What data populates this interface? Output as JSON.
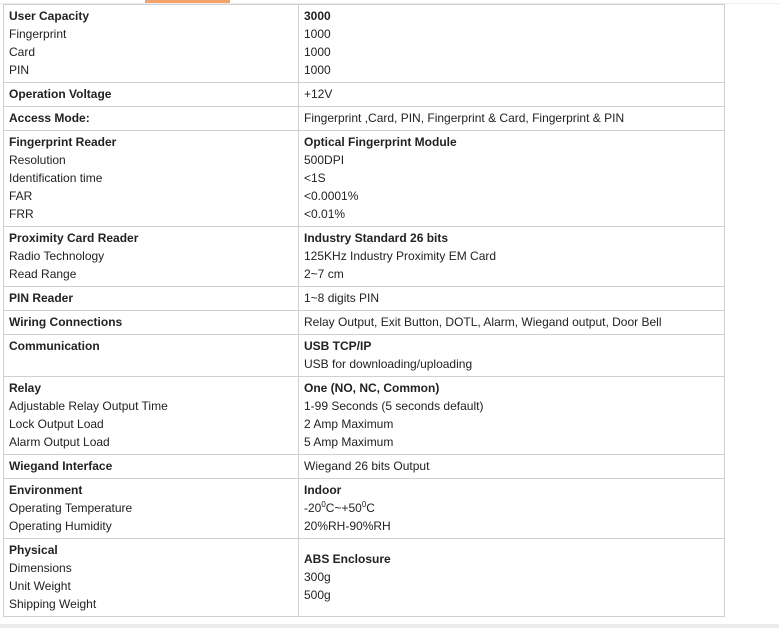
{
  "rows": [
    {
      "label": [
        "User Capacity",
        "Fingerprint",
        "Card",
        "PIN"
      ],
      "value": [
        "3000",
        "1000",
        "1000",
        "1000"
      ]
    },
    {
      "label": [
        "Operation Voltage"
      ],
      "value": [
        "+12V"
      ]
    },
    {
      "label": [
        "Access Mode:"
      ],
      "value": [
        "Fingerprint ,Card, PIN, Fingerprint & Card, Fingerprint & PIN"
      ]
    },
    {
      "label": [
        "Fingerprint Reader",
        "Resolution",
        "Identification time",
        "FAR",
        "FRR"
      ],
      "value": [
        "Optical Fingerprint Module",
        "500DPI",
        "<1S",
        "<0.0001%",
        "<0.01%"
      ]
    },
    {
      "label": [
        "Proximity Card Reader",
        "Radio Technology",
        "Read Range"
      ],
      "value": [
        "Industry Standard 26 bits",
        "125KHz Industry Proximity EM Card",
        "2~7 cm"
      ]
    },
    {
      "label": [
        "PIN Reader"
      ],
      "value": [
        "1~8 digits PIN"
      ]
    },
    {
      "label": [
        "Wiring Connections"
      ],
      "value": [
        "Relay Output, Exit Button, DOTL, Alarm, Wiegand output, Door Bell"
      ]
    },
    {
      "label": [
        "Communication"
      ],
      "value": [
        "USB TCP/IP",
        "USB for downloading/uploading"
      ]
    },
    {
      "label": [
        "Relay",
        "Adjustable Relay Output Time",
        "Lock Output Load",
        "Alarm Output Load"
      ],
      "value": [
        "One (NO, NC, Common)",
        "1-99 Seconds (5 seconds default)",
        "2 Amp Maximum",
        "5 Amp Maximum"
      ]
    },
    {
      "label": [
        "Wiegand Interface"
      ],
      "value": [
        "Wiegand 26 bits Output"
      ]
    },
    {
      "label": [
        "Environment",
        "Operating Temperature",
        "Operating Humidity"
      ],
      "value": [
        "Indoor",
        "",
        "20%RH-90%RH"
      ]
    },
    {
      "label": [
        "Physical",
        "Dimensions",
        "Unit Weight",
        "Shipping Weight"
      ],
      "value": [
        "ABS Enclosure",
        "300g",
        "500g"
      ]
    }
  ],
  "temperature": {
    "low": "-20",
    "high": "+50",
    "unit_degree": "0",
    "unit": "C",
    "sep": "~"
  }
}
